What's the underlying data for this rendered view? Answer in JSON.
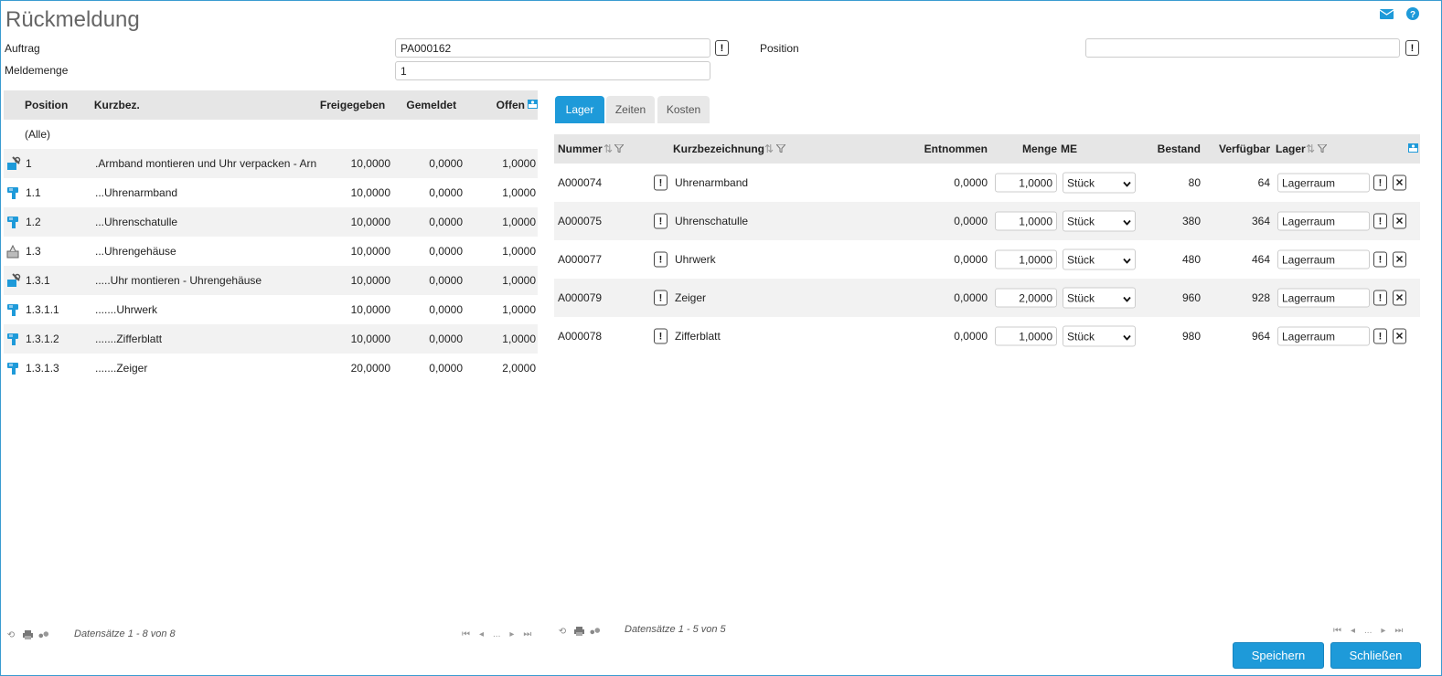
{
  "title": "Rückmeldung",
  "form": {
    "auftrag_label": "Auftrag",
    "auftrag_value": "PA000162",
    "meldemenge_label": "Meldemenge",
    "meldemenge_value": "1",
    "position_label": "Position",
    "position_value": "",
    "info_label": "!"
  },
  "left_table": {
    "headers": {
      "position": "Position",
      "kurzbez": "Kurzbez.",
      "freigegeben": "Freigegeben",
      "gemeldet": "Gemeldet",
      "offen": "Offen"
    },
    "all_label": "(Alle)",
    "rows": [
      {
        "icon": "assembly-icon",
        "position": "1",
        "kurzbez": ".Armband montieren und Uhr verpacken - Arn",
        "freigegeben": "10,0000",
        "gemeldet": "0,0000",
        "offen": "1,0000"
      },
      {
        "icon": "material-icon",
        "position": "1.1",
        "kurzbez": "...Uhrenarmband",
        "freigegeben": "10,0000",
        "gemeldet": "0,0000",
        "offen": "1,0000"
      },
      {
        "icon": "material-icon",
        "position": "1.2",
        "kurzbez": "...Uhrenschatulle",
        "freigegeben": "10,0000",
        "gemeldet": "0,0000",
        "offen": "1,0000"
      },
      {
        "icon": "subassembly-icon",
        "position": "1.3",
        "kurzbez": "...Uhrengehäuse",
        "freigegeben": "10,0000",
        "gemeldet": "0,0000",
        "offen": "1,0000"
      },
      {
        "icon": "assembly-icon",
        "position": "1.3.1",
        "kurzbez": ".....Uhr montieren - Uhrengehäuse",
        "freigegeben": "10,0000",
        "gemeldet": "0,0000",
        "offen": "1,0000"
      },
      {
        "icon": "material-icon",
        "position": "1.3.1.1",
        "kurzbez": ".......Uhrwerk",
        "freigegeben": "10,0000",
        "gemeldet": "0,0000",
        "offen": "1,0000"
      },
      {
        "icon": "material-icon",
        "position": "1.3.1.2",
        "kurzbez": ".......Zifferblatt",
        "freigegeben": "10,0000",
        "gemeldet": "0,0000",
        "offen": "1,0000"
      },
      {
        "icon": "material-icon",
        "position": "1.3.1.3",
        "kurzbez": ".......Zeiger",
        "freigegeben": "20,0000",
        "gemeldet": "0,0000",
        "offen": "2,0000"
      }
    ],
    "footer": "Datensätze 1 - 8 von 8",
    "pager_ellipsis": "..."
  },
  "tabs": [
    "Lager",
    "Zeiten",
    "Kosten"
  ],
  "right_table": {
    "headers": {
      "nummer": "Nummer",
      "kurzbezeichnung": "Kurzbezeichnung",
      "entnommen": "Entnommen",
      "menge": "Menge",
      "me": "ME",
      "bestand": "Bestand",
      "verfuegbar": "Verfügbar",
      "lager": "Lager"
    },
    "rows": [
      {
        "nummer": "A000074",
        "kurzbezeichnung": "Uhrenarmband",
        "entnommen": "0,0000",
        "menge": "1,0000",
        "me": "Stück",
        "bestand": "80",
        "verfuegbar": "64",
        "lager": "Lagerraum"
      },
      {
        "nummer": "A000075",
        "kurzbezeichnung": "Uhrenschatulle",
        "entnommen": "0,0000",
        "menge": "1,0000",
        "me": "Stück",
        "bestand": "380",
        "verfuegbar": "364",
        "lager": "Lagerraum"
      },
      {
        "nummer": "A000077",
        "kurzbezeichnung": "Uhrwerk",
        "entnommen": "0,0000",
        "menge": "1,0000",
        "me": "Stück",
        "bestand": "480",
        "verfuegbar": "464",
        "lager": "Lagerraum"
      },
      {
        "nummer": "A000079",
        "kurzbezeichnung": "Zeiger",
        "entnommen": "0,0000",
        "menge": "2,0000",
        "me": "Stück",
        "bestand": "960",
        "verfuegbar": "928",
        "lager": "Lagerraum"
      },
      {
        "nummer": "A000078",
        "kurzbezeichnung": "Zifferblatt",
        "entnommen": "0,0000",
        "menge": "1,0000",
        "me": "Stück",
        "bestand": "980",
        "verfuegbar": "964",
        "lager": "Lagerraum"
      }
    ],
    "footer": "Datensätze 1 - 5 von 5",
    "pager_ellipsis": "..."
  },
  "buttons": {
    "save": "Speichern",
    "close": "Schließen"
  },
  "colors": {
    "accent": "#1e9ad9",
    "border": "#3a9bd1"
  }
}
